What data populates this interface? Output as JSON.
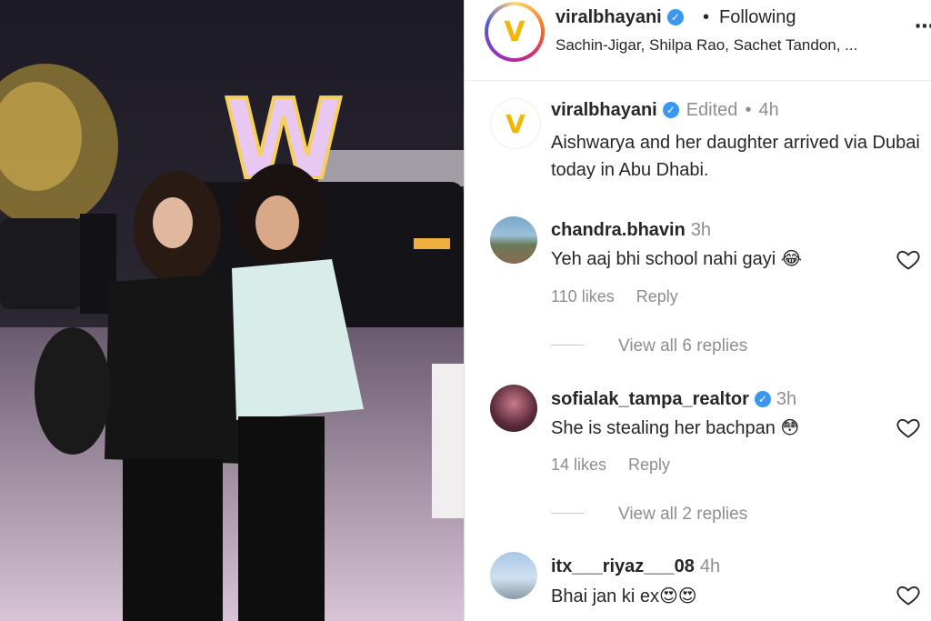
{
  "header": {
    "username": "viralbhayani",
    "separator": "•",
    "follow_status": "Following",
    "audio_subtitle": "Sachin-Jigar, Shilpa Rao, Sachet Tandon, ...",
    "more_icon": "more-options-icon",
    "avatar_letter": "V"
  },
  "caption": {
    "username": "viralbhayani",
    "edited_label": "Edited",
    "separator": "•",
    "time": "4h",
    "text": "Aishwarya and her daughter arrived via Dubai today in Abu Dhabi."
  },
  "comments": [
    {
      "username": "chandra.bhavin",
      "time": "3h",
      "text": "Yeh aaj bhi school nahi gayi 😂",
      "likes": "110 likes",
      "reply_label": "Reply",
      "view_replies": "View all 6 replies",
      "verified": false
    },
    {
      "username": "sofialak_tampa_realtor",
      "time": "3h",
      "text": "She is stealing her bachpan 😳",
      "likes": "14 likes",
      "reply_label": "Reply",
      "view_replies": "View all 2 replies",
      "verified": true
    },
    {
      "username": "itx___riyaz___08",
      "time": "4h",
      "text": "Bhai jan ki ex😍😍",
      "verified": false
    }
  ],
  "photo": {
    "sign_letter": "W"
  },
  "colors": {
    "verified_blue": "#3897f0",
    "brand_yellow": "#f2b705",
    "muted": "#8e8e8e"
  }
}
